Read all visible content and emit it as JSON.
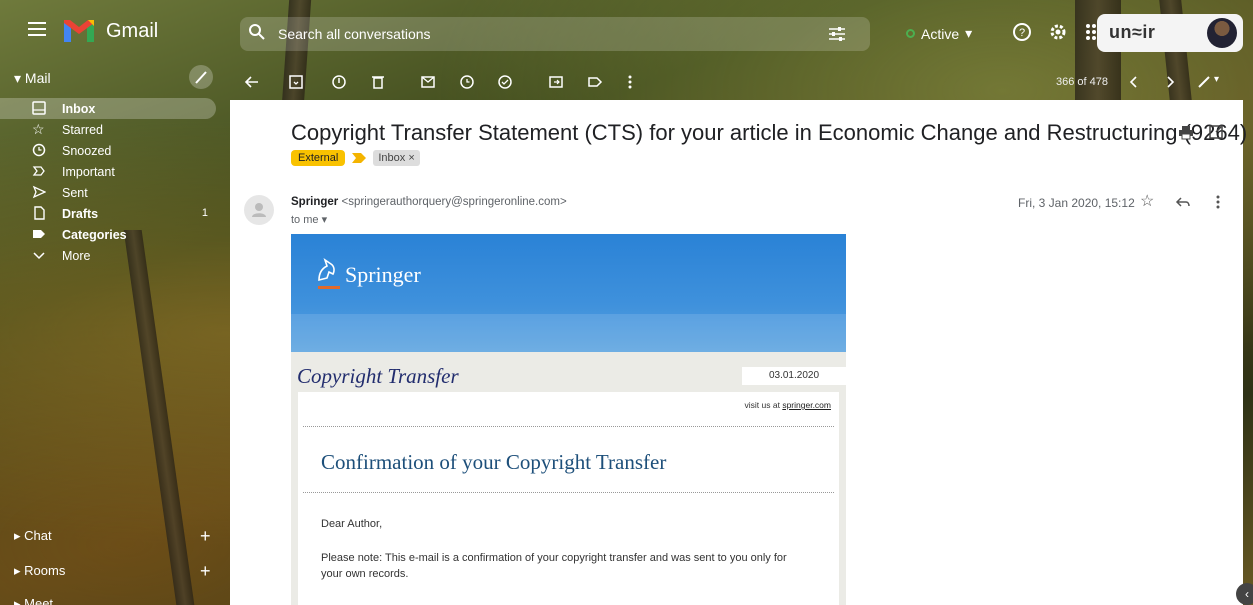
{
  "app": {
    "name": "Gmail"
  },
  "search": {
    "placeholder": "Search all conversations"
  },
  "status": {
    "label": "Active"
  },
  "account": {
    "brand": "un≈ir"
  },
  "sidebar": {
    "section": "Mail",
    "items": [
      {
        "label": "Inbox",
        "icon": "inbox-icon"
      },
      {
        "label": "Starred",
        "icon": "star-icon"
      },
      {
        "label": "Snoozed",
        "icon": "clock-icon"
      },
      {
        "label": "Important",
        "icon": "important-icon"
      },
      {
        "label": "Sent",
        "icon": "send-icon"
      },
      {
        "label": "Drafts",
        "icon": "draft-icon",
        "count": "1"
      },
      {
        "label": "Categories",
        "icon": "label-icon"
      },
      {
        "label": "More",
        "icon": "chevron-down-icon"
      }
    ],
    "bottom": [
      "Chat",
      "Rooms",
      "Meet"
    ]
  },
  "toolbar": {
    "pager": "366 of 478"
  },
  "message": {
    "subject": "Copyright Transfer Statement (CTS) for your article in Economic Change and Restructuring (9264)",
    "labels": {
      "external": "External",
      "inbox": "Inbox ×"
    },
    "sender_name": "Springer",
    "sender_email": "<springerauthorquery@springeronline.com>",
    "to": "to me ▾",
    "date": "Fri, 3 Jan 2020, 15:12"
  },
  "email": {
    "brand": "Springer",
    "title": "Copyright Transfer",
    "date": "03.01.2020",
    "visit_prefix": "visit us at",
    "visit_link": "springer.com",
    "heading": "Confirmation of your Copyright Transfer",
    "greeting": "Dear Author,",
    "note": "Please note: This e-mail is a confirmation of your copyright transfer and was sent to you only for your own records."
  },
  "colors": {
    "external_tag": "#f9c200",
    "springer_blue": "#2a82d6",
    "active_green": "#4caf50"
  }
}
